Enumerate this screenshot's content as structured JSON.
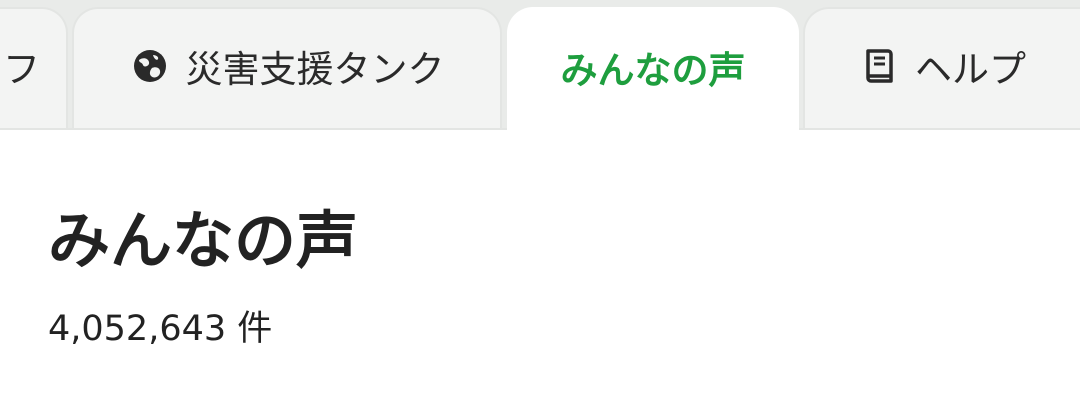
{
  "tabs": [
    {
      "label": "フ",
      "icon": null,
      "active": false
    },
    {
      "label": "災害支援タンク",
      "icon": "globe-icon",
      "active": false
    },
    {
      "label": "みんなの声",
      "icon": null,
      "active": true
    },
    {
      "label": "ヘルプ",
      "icon": "book-icon",
      "active": false
    }
  ],
  "main": {
    "title": "みんなの声",
    "count": "4,052,643 件"
  },
  "colors": {
    "accent": "#1e9e3e",
    "tab_bg": "#f3f4f3",
    "bar_bg": "#e9ebe9",
    "text": "#222222"
  }
}
